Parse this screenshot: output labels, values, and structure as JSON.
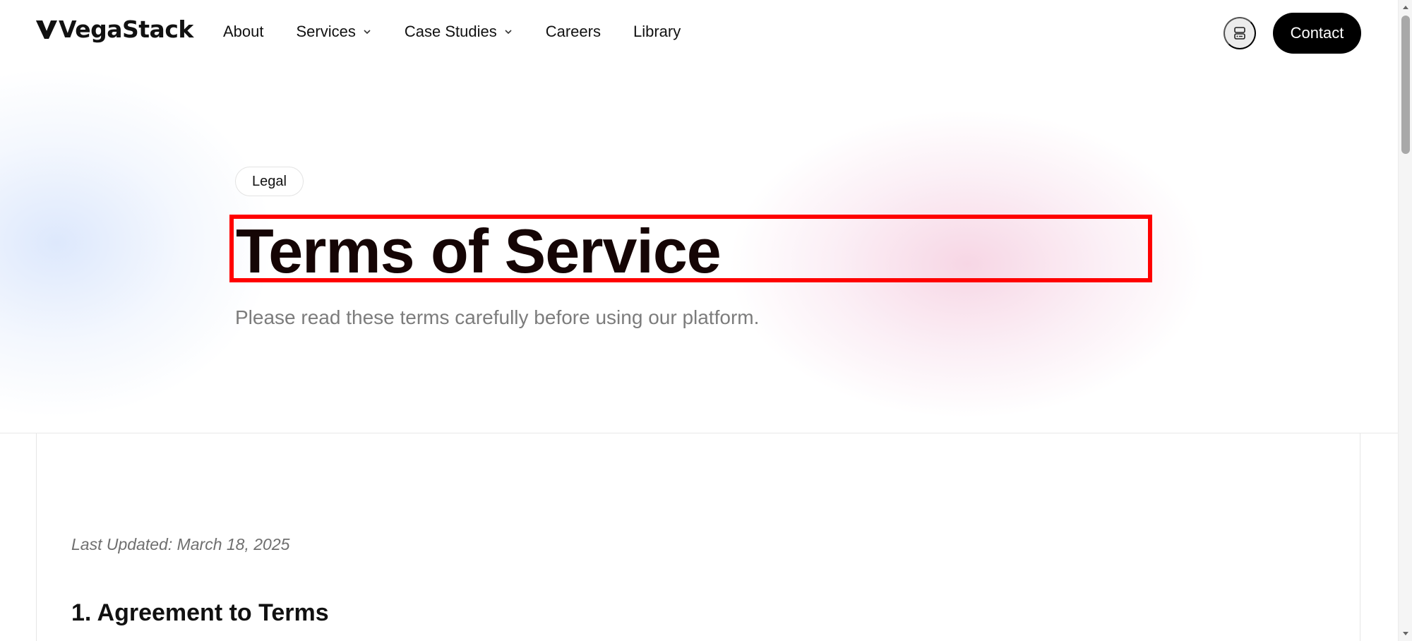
{
  "brand": {
    "name": "VegaStack"
  },
  "nav": {
    "items": [
      {
        "label": "About",
        "has_dropdown": false
      },
      {
        "label": "Services",
        "has_dropdown": true
      },
      {
        "label": "Case Studies",
        "has_dropdown": true
      },
      {
        "label": "Careers",
        "has_dropdown": false
      },
      {
        "label": "Library",
        "has_dropdown": false
      }
    ]
  },
  "header": {
    "icon_button": "server-icon",
    "contact_label": "Contact"
  },
  "hero": {
    "badge": "Legal",
    "title": "Terms of Service",
    "subtitle": "Please read these terms carefully before using our platform."
  },
  "content": {
    "last_updated": "Last Updated: March 18, 2025",
    "sections": [
      {
        "heading": "1. Agreement to Terms"
      }
    ]
  },
  "colors": {
    "highlight_border": "#ff0000",
    "contact_bg": "#000000",
    "title_text": "#150505",
    "subtitle_text": "#7c7c7c"
  }
}
